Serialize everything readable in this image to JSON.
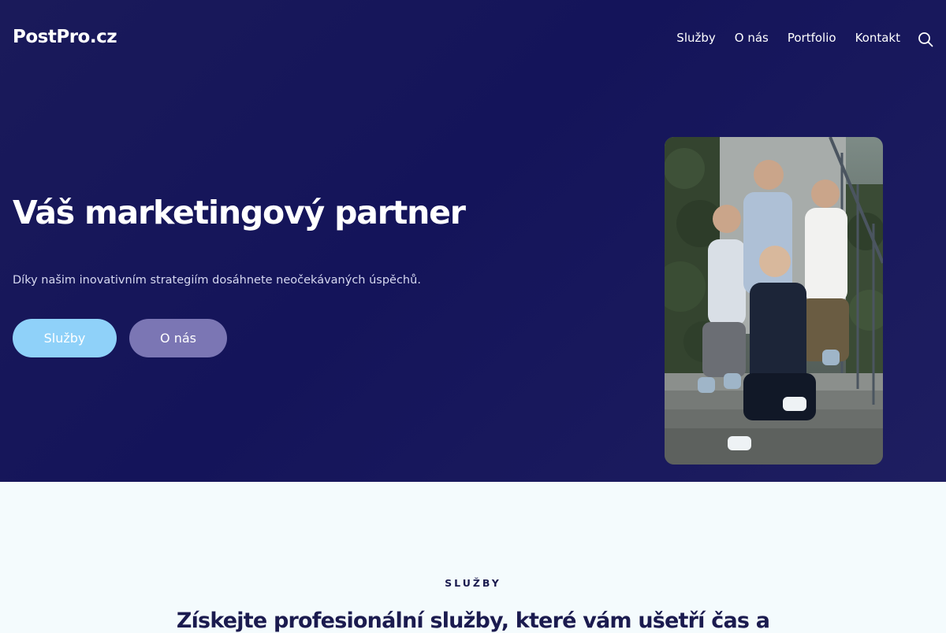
{
  "header": {
    "logo": "PostPro.cz",
    "nav": [
      "Služby",
      "O nás",
      "Portfolio",
      "Kontakt"
    ],
    "search_icon": "search-icon"
  },
  "hero": {
    "title": "Váš marketingový partner",
    "subtitle": "Díky našim inovativním strategiím dosáhnete neočekávaných úspěchů.",
    "primary_button": "Služby",
    "secondary_button": "O nás",
    "photo": "team-photo"
  },
  "services": {
    "eyebrow": "SLUŽBY",
    "heading": "Získejte profesionální služby, které vám ušetří čas a"
  },
  "colors": {
    "hero_bg": "#161657",
    "primary_button": "#8fd1f9",
    "secondary_button": "#7b76b4",
    "section_bg": "#f4fbfd",
    "heading_text": "#1b1b4f"
  }
}
